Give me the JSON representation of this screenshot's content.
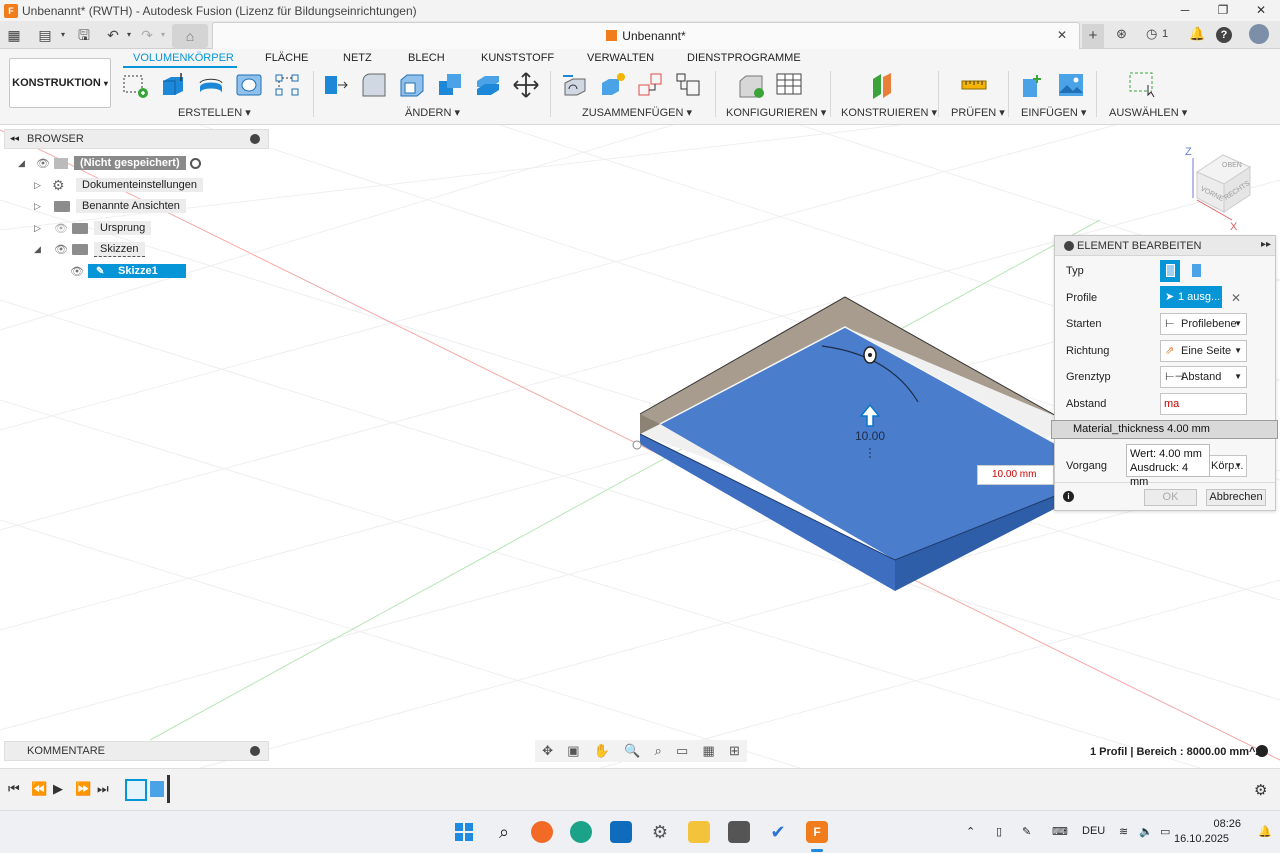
{
  "window": {
    "title": "Unbenannt* (RWTH) - Autodesk Fusion (Lizenz für Bildungseinrichtungen)"
  },
  "doc_tab": {
    "title": "Unbenannt*"
  },
  "quickbar": {
    "notifications": "1"
  },
  "ribbon": {
    "workspace": "KONSTRUKTION",
    "tabs": [
      "VOLUMENKÖRPER",
      "FLÄCHE",
      "NETZ",
      "BLECH",
      "KUNSTSTOFF",
      "VERWALTEN",
      "DIENSTPROGRAMME"
    ],
    "groups": [
      "ERSTELLEN",
      "ÄNDERN",
      "ZUSAMMENFÜGEN",
      "KONFIGURIEREN",
      "KONSTRUIEREN",
      "PRÜFEN",
      "EINFÜGEN",
      "AUSWÄHLEN"
    ]
  },
  "browser": {
    "title": "BROWSER",
    "root": "(Nicht gespeichert)",
    "items": [
      "Dokumenteinstellungen",
      "Benannte Ansichten",
      "Ursprung",
      "Skizzen"
    ],
    "sketch": "Skizze1"
  },
  "comments": {
    "title": "KOMMENTARE"
  },
  "viewcube": {
    "top": "OBEN",
    "front": "VORNE",
    "right": "RECHTS",
    "axis_z": "Z",
    "axis_x": "X"
  },
  "canvas": {
    "drag_value": "10.00",
    "dim_value": "10.00 mm"
  },
  "dialog": {
    "title": "ELEMENT BEARBEITEN",
    "labels": {
      "type": "Typ",
      "profile": "Profile",
      "start": "Starten",
      "direction": "Richtung",
      "extent": "Grenztyp",
      "distance": "Abstand",
      "operation": "Vorgang"
    },
    "profile_value": "1 ausg...",
    "start_value": "Profilebene",
    "direction_value": "Eine Seite",
    "extent_value": "Abstand",
    "distance_value": "ma",
    "operation_value": "Körp...",
    "ok": "OK",
    "cancel": "Abbrechen"
  },
  "autocomplete": {
    "item": "Material_thickness 4.00 mm"
  },
  "tooltip": {
    "line1": "Wert: 4.00 mm",
    "line2": "Ausdruck: 4 mm"
  },
  "status": {
    "text": "1 Profil | Bereich : 8000.00 mm^2"
  },
  "taskbar": {
    "lang": "DEU",
    "time": "08:26",
    "date": "16.10.2025"
  }
}
